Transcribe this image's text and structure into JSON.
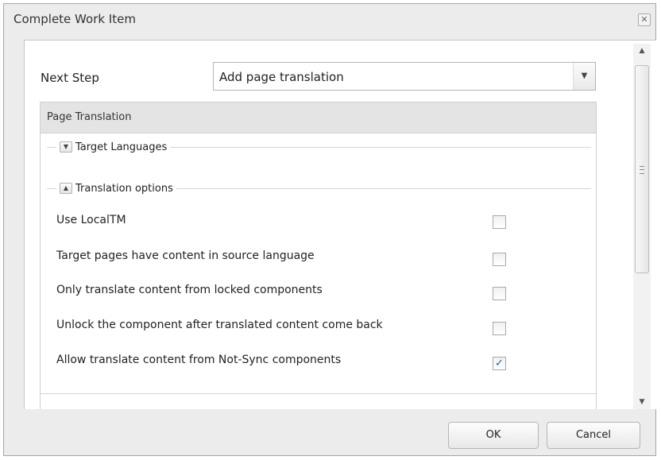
{
  "dialog": {
    "title": "Complete Work Item",
    "close_symbol": "✕"
  },
  "form": {
    "next_step_label": "Next Step",
    "next_step_value": "Add page translation"
  },
  "panel": {
    "title": "Page Translation",
    "target_languages_legend": "Target Languages",
    "translation_options_legend": "Translation options",
    "options": [
      {
        "label": "Use LocalTM",
        "checked": false
      },
      {
        "label": "Target pages have content in source language",
        "checked": false
      },
      {
        "label": "Only translate content from locked components",
        "checked": false
      },
      {
        "label": "Unlock the component after translated content come back",
        "checked": false
      },
      {
        "label": "Allow translate content from Not-Sync components",
        "checked": true
      }
    ]
  },
  "buttons": {
    "ok": "OK",
    "cancel": "Cancel"
  },
  "icons": {
    "dropdown": "chevron-down-icon",
    "collapsed_toggle": "expand-icon",
    "expanded_toggle": "collapse-icon",
    "check_mark": "✓",
    "check_color": "#2c5aa8"
  }
}
